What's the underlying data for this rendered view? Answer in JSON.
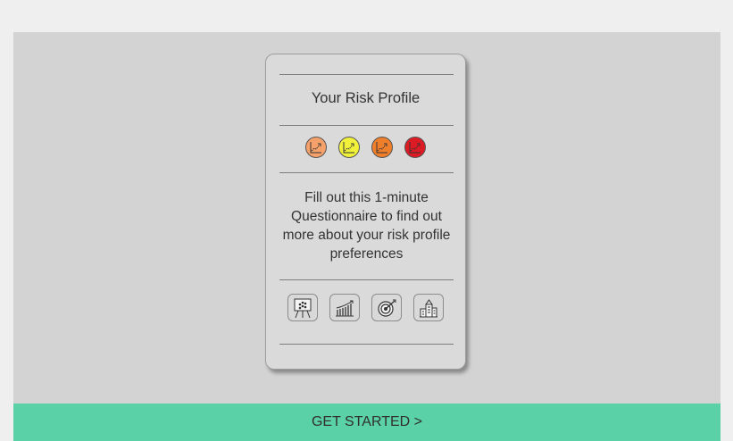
{
  "card": {
    "title": "Your Risk Profile",
    "description": "Fill out this 1-minute Questionnaire to find out more about your risk profile preferences"
  },
  "risk_levels": [
    {
      "name": "risk-level-low",
      "color": "#f6a16a"
    },
    {
      "name": "risk-level-moderate",
      "color": "#f1f13c"
    },
    {
      "name": "risk-level-high",
      "color": "#f07f2c"
    },
    {
      "name": "risk-level-very-high",
      "color": "#dd1b24"
    }
  ],
  "features": [
    {
      "icon": "presentation-board-icon"
    },
    {
      "icon": "bar-chart-growth-icon"
    },
    {
      "icon": "target-icon"
    },
    {
      "icon": "buildings-icon"
    }
  ],
  "cta": {
    "label": "GET STARTED >",
    "color": "#5bd1a8"
  }
}
